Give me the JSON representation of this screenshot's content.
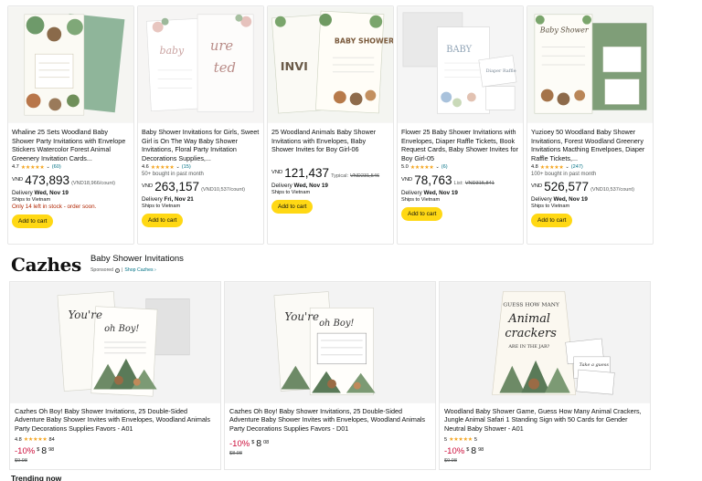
{
  "products": [
    {
      "title": "Whaline 25 Sets Woodland Baby Shower Party Invitations with Envelope Stickers Watercolor Forest Animal Greenery Invitation Cards...",
      "rating": "4.7",
      "stars": "★★★★★",
      "reviews": "(60)",
      "bought": "",
      "currency": "VND",
      "price": "473,893",
      "price_note": "(VND18,966/count)",
      "list_label": "",
      "list_price": "",
      "delivery_label": "Delivery",
      "delivery_date": "Wed, Nov 19",
      "ships": "Ships to Vietnam",
      "stock": "Only 14 left in stock - order soon.",
      "button": "Add to cart"
    },
    {
      "title": "Baby Shower Invitations for Girls, Sweet Girl is On The Way Baby Shower Invitations, Floral Party Invitation Decorations Supplies,...",
      "rating": "4.6",
      "stars": "★★★★★",
      "reviews": "(15)",
      "bought": "50+ bought in past month",
      "currency": "VND",
      "price": "263,157",
      "price_note": "(VND10,537/count)",
      "list_label": "",
      "list_price": "",
      "delivery_label": "Delivery",
      "delivery_date": "Fri, Nov 21",
      "ships": "Ships to Vietnam",
      "stock": "",
      "button": "Add to cart"
    },
    {
      "title": "25 Woodland Animals Baby Shower Invitations with Envelopes, Baby Shower Invites for Boy Girl-06",
      "rating": "",
      "stars": "",
      "reviews": "",
      "bought": "",
      "currency": "VND",
      "price": "121,437",
      "price_note": "",
      "list_label": "Typical:",
      "list_price": "VND231,546",
      "delivery_label": "Delivery",
      "delivery_date": "Wed, Nov 19",
      "ships": "Ships to Vietnam",
      "stock": "",
      "button": "Add to cart"
    },
    {
      "title": "Flower 25 Baby Shower Invitations with Envelopes, Diaper Raffle Tickets, Book Request Cards, Baby Shower Invites for Boy Girl-05",
      "rating": "5.0",
      "stars": "★★★★★",
      "reviews": "(6)",
      "bought": "",
      "currency": "VND",
      "price": "78,763",
      "price_note": "",
      "list_label": "List:",
      "list_price": "VND315,841",
      "delivery_label": "Delivery",
      "delivery_date": "Wed, Nov 19",
      "ships": "Ships to Vietnam",
      "stock": "",
      "button": "Add to cart"
    },
    {
      "title": "Yuzioey 50 Woodland Baby Shower Invitations, Forest Woodland Greenery Invitations Macthing Envelpoes, Diaper Raffle Tickets,...",
      "rating": "4.8",
      "stars": "★★★★★",
      "reviews": "(247)",
      "bought": "100+ bought in past month",
      "currency": "VND",
      "price": "526,577",
      "price_note": "(VND10,537/count)",
      "list_label": "",
      "list_price": "",
      "delivery_label": "Delivery",
      "delivery_date": "Wed, Nov 19",
      "ships": "Ships to Vietnam",
      "stock": "",
      "button": "Add to cart"
    }
  ],
  "sponsored_brand": {
    "logo": "Cazhes",
    "title": "Baby Shower Invitations",
    "sponsored": "Sponsored",
    "separator": "|",
    "shop_link": "Shop Cazhes ›"
  },
  "sponsored_products": [
    {
      "title": "Cazhes Oh Boy! Baby Shower Invitations, 25 Double-Sided Adventure Baby Shower Invites with Envelopes, Woodland Animals Party Decorations Supplies Favors - A01",
      "rating": "4.8",
      "stars": "★★★★★",
      "reviews": "84",
      "discount": "-10%",
      "dollar": "$",
      "whole": "8",
      "cents": "98",
      "list": "$9.98"
    },
    {
      "title": "Cazhes Oh Boy! Baby Shower Invitations, 25 Double-Sided Adventure Baby Shower Invites with Envelopes, Woodland Animals Party Decorations Supplies Favors - D01",
      "rating": "",
      "stars": "",
      "reviews": "",
      "discount": "-10%",
      "dollar": "$",
      "whole": "8",
      "cents": "08",
      "list": "$8.98"
    },
    {
      "title": "Woodland Baby Shower Game, Guess How Many Animal Crackers, Jungle Animal Safari 1 Standing Sign with 50 Cards for Gender Neutral Baby Shower - A01",
      "rating": "5",
      "stars": "★★★★★",
      "reviews": "5",
      "discount": "-10%",
      "dollar": "$",
      "whole": "8",
      "cents": "98",
      "list": "$9.98"
    }
  ],
  "image_text": {
    "p2_script": "ure",
    "p2_script2": "ted",
    "p2_baby": "baby",
    "p3_big": "BABY SHOWER",
    "p3_inv": "INVI",
    "p4_baby": "BABY",
    "p4_raffle": "Diaper Raffle",
    "p5_head": "Baby Shower",
    "s1_youre": "You're",
    "s1_oh": "oh Boy!",
    "s2_youre": "You're",
    "s2_oh": "oh Boy!",
    "s3_guess": "GUESS HOW MANY",
    "s3_animal": "Animal",
    "s3_crackers": "crackers",
    "s3_jar": "ARE IN THE JAR?",
    "s3_take": "Take a guess"
  },
  "trending": "Trending now",
  "colors": {
    "button": "#ffd814",
    "star": "#f4a41d",
    "link": "#007185",
    "discount": "#cc0c39",
    "stock": "#b12704"
  }
}
